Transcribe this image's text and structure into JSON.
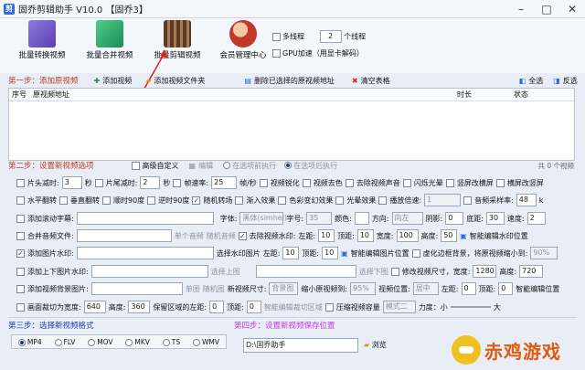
{
  "window": {
    "title": "固乔剪辑助手 V10.0 【固乔3】"
  },
  "toolbar": {
    "items": [
      {
        "label": "批量转换视频",
        "color": "#6c4fb8"
      },
      {
        "label": "批量合并视频",
        "color": "#2aa86a"
      },
      {
        "label": "批量剪辑视频",
        "color": "#7a4a2a"
      },
      {
        "label": "会员管理中心",
        "color": "#c0392b"
      }
    ],
    "multithread_label": "多线程",
    "thread_count": "2",
    "thread_unit": "个线程",
    "gpu_label": "GPU加速（用显卡解码）"
  },
  "step1": {
    "title": "第一步：添加原视频",
    "add_video": "添加视频",
    "add_folder": "添加视频文件夹",
    "delete_selected": "删除已选择的原视频地址",
    "clear_table": "清空表格",
    "select_all": "全选",
    "invert": "反选",
    "columns": [
      "序号",
      "原视频地址",
      "时长",
      "状态"
    ],
    "count": "共 0 个视频"
  },
  "step2": {
    "title": "第二步：设置新视频选项",
    "advanced": "高级自定义",
    "edit": "编辑",
    "before": "在选项前执行",
    "after": "在选项后执行",
    "r1": {
      "head_cut": "片头减时:",
      "head_val": "3",
      "sec1": "秒",
      "tail_cut": "片尾减时:",
      "tail_val": "2",
      "sec2": "秒",
      "fps": "帧速率:",
      "fps_val": "25",
      "fps_unit": "帧/秒",
      "sharpen": "视频锐化",
      "decolor": "视频去色",
      "remove_audio": "去除视频声音",
      "flash": "闪烁光晕",
      "portrait_to_landscape": "竖屏改横屏",
      "landscape_to_portrait": "横屏改竖屏"
    },
    "r2": {
      "hflip": "水平翻转",
      "vflip": "垂直翻转",
      "cw90": "顺时90度",
      "ccw90": "逆时90度",
      "random_transition": "随机转场",
      "fade_in": "渐入效果",
      "color_contrast": "色彩变幻效果",
      "light": "光晕效果",
      "speed": "播放倍速:",
      "speed_val": "1",
      "sample_rate": "音频采样率:",
      "sample_val": "48",
      "sample_unit": "k"
    },
    "r3": {
      "scroll_sub": "添加滚动字幕:",
      "font": "字体:",
      "font_val": "黑体(simhei)",
      "size": "字号:",
      "size_val": "35",
      "color": "颜色:",
      "direction": "方向:",
      "direction_val": "向左",
      "shadow": "阴影:",
      "shadow_val": "0",
      "bottom": "底距:",
      "bottom_val": "30",
      "speed": "速度:",
      "speed_val": "2"
    },
    "r4": {
      "merge_audio": "合并音频文件:",
      "single_audio": "单个音频",
      "random_audio": "随机音频",
      "remove_wm": "去除视频水印:",
      "left": "左距:",
      "left_val": "10",
      "top": "顶距:",
      "top_val": "10",
      "width": "宽度:",
      "width_val": "100",
      "height": "高度:",
      "height_val": "50",
      "smart_wm": "智能编辑水印位置"
    },
    "r5": {
      "add_img_wm": "添加图片水印:",
      "select_wm": "选择水印图片",
      "left": "左距:",
      "left_val": "10",
      "top": "顶距:",
      "top_val": "10",
      "smart_img": "智能编辑图片位置",
      "blur_bg": "虚化边框背景，将原视频缩小到:",
      "blur_val": "90%"
    },
    "r6": {
      "add_tb": "添加上下图片水印:",
      "select_top": "选择上图",
      "select_bottom": "选择下图",
      "resize": "修改视频尺寸，宽度:",
      "w_val": "1280",
      "height": "高度:",
      "h_val": "720"
    },
    "r7": {
      "add_bg": "添加视频背景图片:",
      "single_img": "单图",
      "random_img": "随机图",
      "new_size": "新视频尺寸:",
      "new_size_val": "背景图",
      "shrink": "缩小原视频到:",
      "shrink_val": "95%",
      "pos": "视频位置:",
      "pos_val": "居中",
      "left": "左距:",
      "left_val": "0",
      "top": "顶距:",
      "top_val": "0",
      "smart_pos": "智能编辑位置"
    },
    "r8": {
      "crop": "画面裁切为宽度:",
      "crop_w": "640",
      "height": "高度:",
      "crop_h": "360",
      "keep_left": "保留区域的左距:",
      "left_val": "0",
      "top": "顶距:",
      "top_val": "0",
      "smart_crop": "智能编辑裁切区域",
      "compress": "压缩视频容量",
      "mode_val": "模式二",
      "strength": "力度：小",
      "large": "大"
    }
  },
  "step3": {
    "title": "第三步：选择新视频格式",
    "formats": [
      "MP4",
      "FLV",
      "MOV",
      "MKV",
      "TS",
      "WMV"
    ]
  },
  "step4": {
    "title": "第四步：设置新视频保存位置",
    "path": "D:\\固乔助手",
    "browse": "浏览"
  },
  "watermark": {
    "text": "赤鸡游戏"
  },
  "colors": {
    "accent": "#1f3fa8",
    "step_red": "#c0392b",
    "bg": "#e9eef6"
  }
}
